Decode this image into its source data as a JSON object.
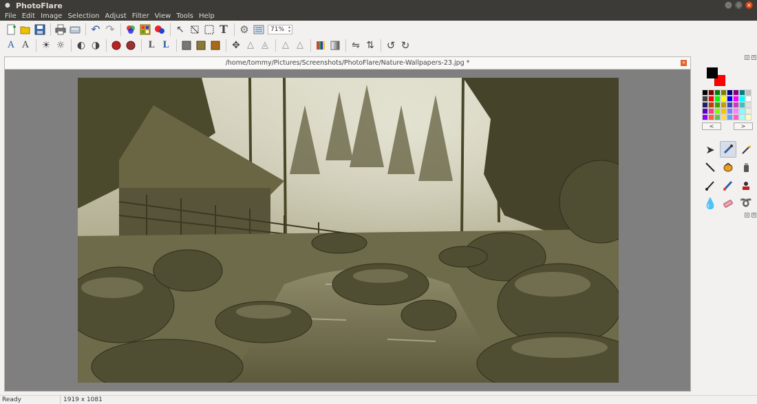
{
  "window": {
    "title": "PhotoFlare"
  },
  "menu": [
    "File",
    "Edit",
    "Image",
    "Selection",
    "Adjust",
    "Filter",
    "View",
    "Tools",
    "Help"
  ],
  "toolbar": {
    "zoom_value": "71%"
  },
  "document": {
    "title": "/home/tommy/Pictures/Screenshots/PhotoFlare/Nature-Wallpapers-23.jpg *"
  },
  "palette": {
    "primary_color": "#000000",
    "secondary_color": "#ff0000",
    "swatches": [
      "#000000",
      "#800000",
      "#008000",
      "#808000",
      "#000080",
      "#800080",
      "#008080",
      "#c0c0c0",
      "#404040",
      "#ff0000",
      "#00ff00",
      "#ffff00",
      "#0000ff",
      "#ff00ff",
      "#00ffff",
      "#ffffff",
      "#202060",
      "#c04000",
      "#40a000",
      "#c0a000",
      "#4040c0",
      "#c040c0",
      "#40c0c0",
      "#e0e0e0",
      "#6000c0",
      "#ff4080",
      "#80ff00",
      "#ffc000",
      "#8080ff",
      "#ff80ff",
      "#80ffff",
      "#f0f0e0",
      "#9000ff",
      "#ff6040",
      "#60c060",
      "#ffe040",
      "#60a0ff",
      "#ff60c0",
      "#a0ffff",
      "#ffffc0"
    ],
    "prev_label": "<",
    "next_label": ">"
  },
  "status": {
    "ready": "Ready",
    "image_size": "1919 x 1081"
  }
}
